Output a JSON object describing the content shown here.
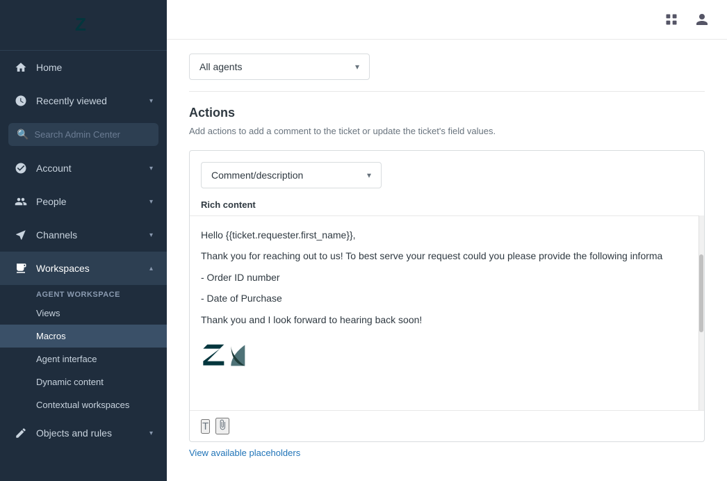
{
  "sidebar": {
    "logo_alt": "Zendesk logo",
    "nav_items": [
      {
        "id": "home",
        "label": "Home",
        "icon": "home-icon",
        "expandable": false
      },
      {
        "id": "recently-viewed",
        "label": "Recently viewed",
        "icon": "clock-icon",
        "expandable": true
      },
      {
        "id": "account",
        "label": "Account",
        "icon": "account-icon",
        "expandable": true
      },
      {
        "id": "people",
        "label": "People",
        "icon": "people-icon",
        "expandable": true
      },
      {
        "id": "channels",
        "label": "Channels",
        "icon": "channels-icon",
        "expandable": true
      },
      {
        "id": "workspaces",
        "label": "Workspaces",
        "icon": "workspaces-icon",
        "expandable": true,
        "active": true
      },
      {
        "id": "objects-and-rules",
        "label": "Objects and rules",
        "icon": "objects-icon",
        "expandable": true
      }
    ],
    "search_placeholder": "Search Admin Center",
    "workspaces_subnav": {
      "header": "Agent workspace",
      "items": [
        {
          "id": "views",
          "label": "Views",
          "active": false
        },
        {
          "id": "macros",
          "label": "Macros",
          "active": true
        },
        {
          "id": "agent-interface",
          "label": "Agent interface",
          "active": false
        },
        {
          "id": "dynamic-content",
          "label": "Dynamic content",
          "active": false
        },
        {
          "id": "contextual-workspaces",
          "label": "Contextual workspaces",
          "active": false
        }
      ]
    }
  },
  "topbar": {
    "grid_icon": "grid-icon",
    "user_icon": "user-icon"
  },
  "content": {
    "agent_dropdown": {
      "value": "All agents",
      "label": "All agents"
    },
    "actions_section": {
      "title": "Actions",
      "description": "Add actions to add a comment to the ticket or update the ticket's field values."
    },
    "comment_dropdown": {
      "value": "Comment/description",
      "label": "Comment/description"
    },
    "rich_content_label": "Rich content",
    "editor_content": {
      "line1": "Hello {{ticket.requester.first_name}},",
      "line2": "Thank you for reaching out to us! To best serve your request could you please provide the following informa",
      "line3": "- Order ID number",
      "line4": "- Date of Purchase",
      "line5": "Thank you and I look forward to hearing back soon!"
    },
    "toolbar": {
      "text_btn": "T",
      "attachment_btn": "📎"
    },
    "placeholder_link": "View available placeholders"
  }
}
